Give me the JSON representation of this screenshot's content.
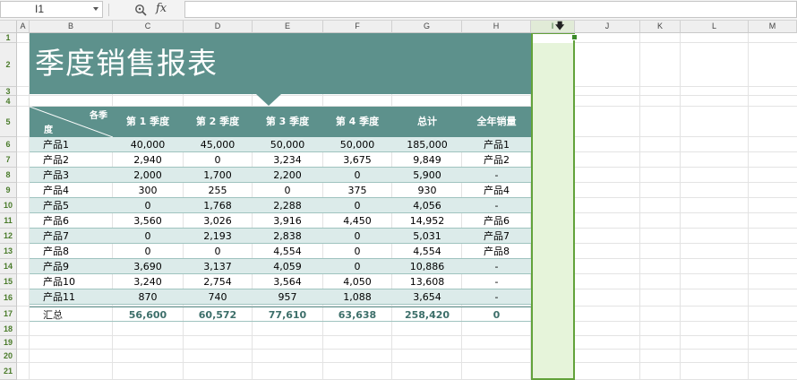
{
  "formula_bar": {
    "name_box": "I1",
    "fx_label": "fx",
    "formula": ""
  },
  "columns": [
    "A",
    "B",
    "C",
    "D",
    "E",
    "F",
    "G",
    "H",
    "I",
    "J",
    "K",
    "L",
    "M"
  ],
  "rows": [
    "1",
    "2",
    "3",
    "4",
    "5",
    "6",
    "7",
    "8",
    "9",
    "10",
    "11",
    "12",
    "13",
    "14",
    "15",
    "16",
    "17",
    "18",
    "19",
    "20",
    "21"
  ],
  "report": {
    "title": "季度销售报表",
    "diag_top": "各季",
    "diag_bottom": "度",
    "headers": [
      "第 1 季度",
      "第 2 季度",
      "第 3 季度",
      "第 4 季度",
      "总计",
      "全年销量"
    ],
    "rows": [
      [
        "产品1",
        "40,000",
        "45,000",
        "50,000",
        "50,000",
        "185,000",
        "产品1"
      ],
      [
        "产品2",
        "2,940",
        "0",
        "3,234",
        "3,675",
        "9,849",
        "产品2"
      ],
      [
        "产品3",
        "2,000",
        "1,700",
        "2,200",
        "0",
        "5,900",
        "-"
      ],
      [
        "产品4",
        "300",
        "255",
        "0",
        "375",
        "930",
        "产品4"
      ],
      [
        "产品5",
        "0",
        "1,768",
        "2,288",
        "0",
        "4,056",
        "-"
      ],
      [
        "产品6",
        "3,560",
        "3,026",
        "3,916",
        "4,450",
        "14,952",
        "产品6"
      ],
      [
        "产品7",
        "0",
        "2,193",
        "2,838",
        "0",
        "5,031",
        "产品7"
      ],
      [
        "产品8",
        "0",
        "0",
        "4,554",
        "0",
        "4,554",
        "产品8"
      ],
      [
        "产品9",
        "3,690",
        "3,137",
        "4,059",
        "0",
        "10,886",
        "-"
      ],
      [
        "产品10",
        "3,240",
        "2,754",
        "3,564",
        "4,050",
        "13,608",
        "-"
      ],
      [
        "产品11",
        "870",
        "740",
        "957",
        "1,088",
        "3,654",
        "-"
      ]
    ],
    "summary": [
      "汇总",
      "56,600",
      "60,572",
      "77,610",
      "63,638",
      "258,420",
      "0"
    ]
  },
  "colors": {
    "header_teal": "#5d918c",
    "alt_row": "#dcebea",
    "selection_green": "#62a23a"
  }
}
